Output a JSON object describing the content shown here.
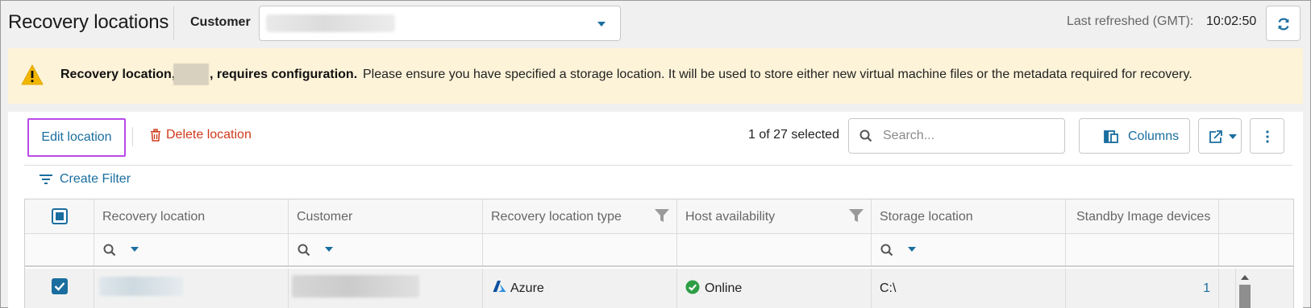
{
  "header": {
    "title": "Recovery locations",
    "customer_label": "Customer",
    "customer_value": "",
    "last_refreshed_label": "Last refreshed (GMT):",
    "last_refreshed_time": "10:02:50"
  },
  "banner": {
    "bold_prefix": "Recovery location,",
    "bold_suffix": ", requires configuration.",
    "message": "Please ensure you have specified a storage location. It will be used to store either new virtual machine files or the metadata required for recovery."
  },
  "toolbar": {
    "edit_label": "Edit location",
    "delete_label": "Delete location",
    "selection_count": "1 of 27 selected",
    "search_placeholder": "Search...",
    "columns_label": "Columns",
    "create_filter_label": "Create Filter"
  },
  "grid": {
    "columns": [
      "Recovery location",
      "Customer",
      "Recovery location type",
      "Host availability",
      "Storage location",
      "Standby Image devices"
    ],
    "rows": [
      {
        "checked": true,
        "recovery_location": "",
        "customer": "",
        "type": "Azure",
        "host_availability": "Online",
        "storage_location": "C:\\",
        "standby_image_devices": "1"
      }
    ]
  },
  "colors": {
    "accent": "#1a6e9f",
    "danger": "#d0391c",
    "highlight_border": "#b94ae8",
    "banner_bg": "#fdf3d8",
    "online": "#2e9e45"
  },
  "icons": {
    "refresh": "refresh-icon",
    "warning": "warning-icon",
    "delete": "trash-icon",
    "search": "search-icon",
    "columns": "columns-icon",
    "export": "export-icon",
    "more": "more-vertical-icon",
    "filter": "filter-icon",
    "azure": "azure-icon",
    "online": "check-circle-icon"
  }
}
